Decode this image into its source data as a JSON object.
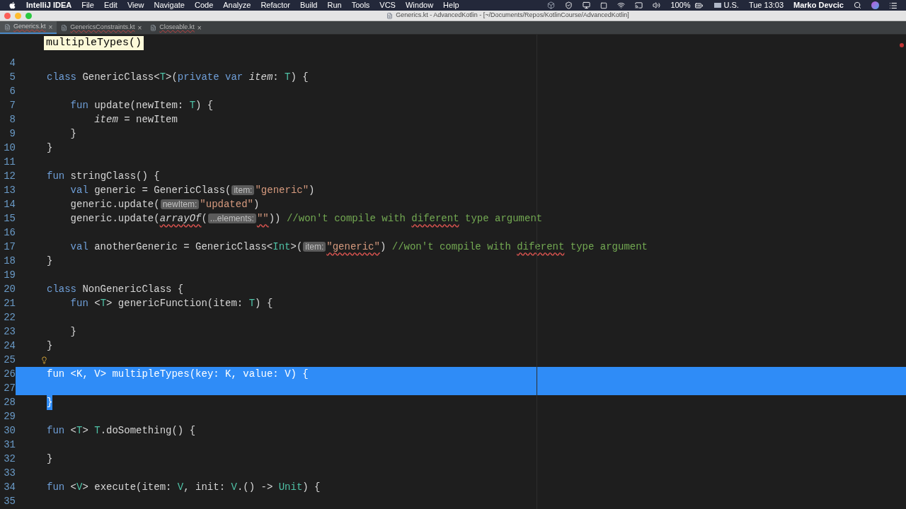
{
  "menubar": {
    "app": "IntelliJ IDEA",
    "menus": [
      "File",
      "Edit",
      "View",
      "Navigate",
      "Code",
      "Analyze",
      "Refactor",
      "Build",
      "Run",
      "Tools",
      "VCS",
      "Window",
      "Help"
    ],
    "battery": "100%",
    "input_source": "U.S.",
    "clock": "Tue 13:03",
    "user": "Marko Devcic"
  },
  "window": {
    "title": "Generics.kt - AdvancedKotlin - [~/Documents/Repos/KotlinCourse/AdvancedKotlin]"
  },
  "tabs": [
    {
      "label": "Generics.kt",
      "close": "×",
      "selected": true
    },
    {
      "label": "GenericsConstraints.kt",
      "close": "×",
      "selected": false
    },
    {
      "label": "Closeable.kt",
      "close": "×",
      "selected": false
    }
  ],
  "tooltip": "multipleTypes()",
  "lines": [
    {
      "n": "4",
      "selected": false
    },
    {
      "n": "5",
      "selected": false,
      "tokens": [
        {
          "t": "class",
          "kind": "kw"
        },
        {
          "t": " GenericClass<",
          "kind": "plain"
        },
        {
          "t": "T",
          "kind": "type"
        },
        {
          "t": ">(",
          "kind": "plain"
        },
        {
          "t": "private var ",
          "kind": "kw"
        },
        {
          "t": "item",
          "kind": "field"
        },
        {
          "t": ": ",
          "kind": "plain"
        },
        {
          "t": "T",
          "kind": "type"
        },
        {
          "t": ") {",
          "kind": "plain"
        }
      ]
    },
    {
      "n": "6",
      "selected": false
    },
    {
      "n": "7",
      "selected": false,
      "tokens": [
        {
          "t": "    fun",
          "kind": "kw"
        },
        {
          "t": " update(newItem: ",
          "kind": "plain"
        },
        {
          "t": "T",
          "kind": "type"
        },
        {
          "t": ") {",
          "kind": "plain"
        }
      ]
    },
    {
      "n": "8",
      "selected": false,
      "tokens": [
        {
          "t": "        item",
          "kind": "field"
        },
        {
          "t": " = newItem",
          "kind": "plain"
        }
      ]
    },
    {
      "n": "9",
      "selected": false,
      "tokens": [
        {
          "t": "    }",
          "kind": "plain"
        }
      ]
    },
    {
      "n": "10",
      "selected": false,
      "tokens": [
        {
          "t": "}",
          "kind": "plain"
        }
      ]
    },
    {
      "n": "11",
      "selected": false
    },
    {
      "n": "12",
      "selected": false,
      "tokens": [
        {
          "t": "fun",
          "kind": "kw"
        },
        {
          "t": " stringClass() {",
          "kind": "plain"
        }
      ]
    },
    {
      "n": "13",
      "selected": false,
      "tokens": [
        {
          "t": "    val",
          "kind": "kw"
        },
        {
          "t": " generic = GenericClass(",
          "kind": "plain"
        },
        {
          "t": "item:",
          "kind": "hint"
        },
        {
          "t": "\"generic\"",
          "kind": "str"
        },
        {
          "t": ")",
          "kind": "plain"
        }
      ]
    },
    {
      "n": "14",
      "selected": false,
      "tokens": [
        {
          "t": "    generic.update(",
          "kind": "plain"
        },
        {
          "t": "newItem:",
          "kind": "hint"
        },
        {
          "t": "\"updated\"",
          "kind": "str"
        },
        {
          "t": ")",
          "kind": "plain"
        }
      ]
    },
    {
      "n": "15",
      "selected": false,
      "tokens": [
        {
          "t": "    generic.update(",
          "kind": "plain"
        },
        {
          "t": "arrayOf",
          "kind": "field",
          "wavy": true
        },
        {
          "t": "(",
          "kind": "plain"
        },
        {
          "t": "...elements:",
          "kind": "hint"
        },
        {
          "t": "\"\"",
          "kind": "str",
          "wavy": true
        },
        {
          "t": ")) ",
          "kind": "plain"
        },
        {
          "t": "//won't compile with ",
          "kind": "comment"
        },
        {
          "t": "diferent",
          "kind": "comment",
          "wavy": true
        },
        {
          "t": " type argument",
          "kind": "comment"
        }
      ]
    },
    {
      "n": "16",
      "selected": false
    },
    {
      "n": "17",
      "selected": false,
      "tokens": [
        {
          "t": "    val",
          "kind": "kw"
        },
        {
          "t": " anotherGeneric = GenericClass<",
          "kind": "plain"
        },
        {
          "t": "Int",
          "kind": "type"
        },
        {
          "t": ">(",
          "kind": "plain"
        },
        {
          "t": "item:",
          "kind": "hint"
        },
        {
          "t": "\"generic\"",
          "kind": "str",
          "wavy": true
        },
        {
          "t": ") ",
          "kind": "plain"
        },
        {
          "t": "//won't compile with ",
          "kind": "comment"
        },
        {
          "t": "diferent",
          "kind": "comment",
          "wavy": true
        },
        {
          "t": " type argument",
          "kind": "comment"
        }
      ]
    },
    {
      "n": "18",
      "selected": false,
      "tokens": [
        {
          "t": "}",
          "kind": "plain"
        }
      ]
    },
    {
      "n": "19",
      "selected": false
    },
    {
      "n": "20",
      "selected": false,
      "tokens": [
        {
          "t": "class",
          "kind": "kw"
        },
        {
          "t": " NonGenericClass {",
          "kind": "plain"
        }
      ]
    },
    {
      "n": "21",
      "selected": false,
      "tokens": [
        {
          "t": "    fun",
          "kind": "kw"
        },
        {
          "t": " <",
          "kind": "plain"
        },
        {
          "t": "T",
          "kind": "type"
        },
        {
          "t": "> genericFunction(item: ",
          "kind": "plain"
        },
        {
          "t": "T",
          "kind": "type"
        },
        {
          "t": ") {",
          "kind": "plain"
        }
      ]
    },
    {
      "n": "22",
      "selected": false
    },
    {
      "n": "23",
      "selected": false,
      "tokens": [
        {
          "t": "    }",
          "kind": "plain"
        }
      ]
    },
    {
      "n": "24",
      "selected": false,
      "tokens": [
        {
          "t": "}",
          "kind": "plain"
        }
      ]
    },
    {
      "n": "25",
      "selected": false,
      "lightbulb": true
    },
    {
      "n": "26",
      "selected": true,
      "tokens": [
        {
          "t": "fun",
          "kind": "kw"
        },
        {
          "t": " <",
          "kind": "plain"
        },
        {
          "t": "K",
          "kind": "type"
        },
        {
          "t": ", ",
          "kind": "plain"
        },
        {
          "t": "V",
          "kind": "type"
        },
        {
          "t": "> multipleTypes(key: ",
          "kind": "plain"
        },
        {
          "t": "K",
          "kind": "type"
        },
        {
          "t": ", value: ",
          "kind": "plain"
        },
        {
          "t": "V",
          "kind": "type"
        },
        {
          "t": ") {",
          "kind": "plain"
        }
      ]
    },
    {
      "n": "27",
      "selected": true
    },
    {
      "n": "28",
      "selected": false,
      "text_selected": true,
      "tokens": [
        {
          "t": "}",
          "kind": "plain"
        }
      ]
    },
    {
      "n": "29",
      "selected": false
    },
    {
      "n": "30",
      "selected": false,
      "tokens": [
        {
          "t": "fun",
          "kind": "kw"
        },
        {
          "t": " <",
          "kind": "plain"
        },
        {
          "t": "T",
          "kind": "type"
        },
        {
          "t": "> ",
          "kind": "plain"
        },
        {
          "t": "T",
          "kind": "type"
        },
        {
          "t": ".doSomething() {",
          "kind": "plain"
        }
      ]
    },
    {
      "n": "31",
      "selected": false
    },
    {
      "n": "32",
      "selected": false,
      "tokens": [
        {
          "t": "}",
          "kind": "plain"
        }
      ]
    },
    {
      "n": "33",
      "selected": false
    },
    {
      "n": "34",
      "selected": false,
      "tokens": [
        {
          "t": "fun",
          "kind": "kw"
        },
        {
          "t": " <",
          "kind": "plain"
        },
        {
          "t": "V",
          "kind": "type"
        },
        {
          "t": "> execute(item: ",
          "kind": "plain"
        },
        {
          "t": "V",
          "kind": "type"
        },
        {
          "t": ", init: ",
          "kind": "plain"
        },
        {
          "t": "V",
          "kind": "type"
        },
        {
          "t": ".() -> ",
          "kind": "plain"
        },
        {
          "t": "Unit",
          "kind": "type"
        },
        {
          "t": ") {",
          "kind": "plain"
        }
      ]
    },
    {
      "n": "35",
      "selected": false
    }
  ]
}
